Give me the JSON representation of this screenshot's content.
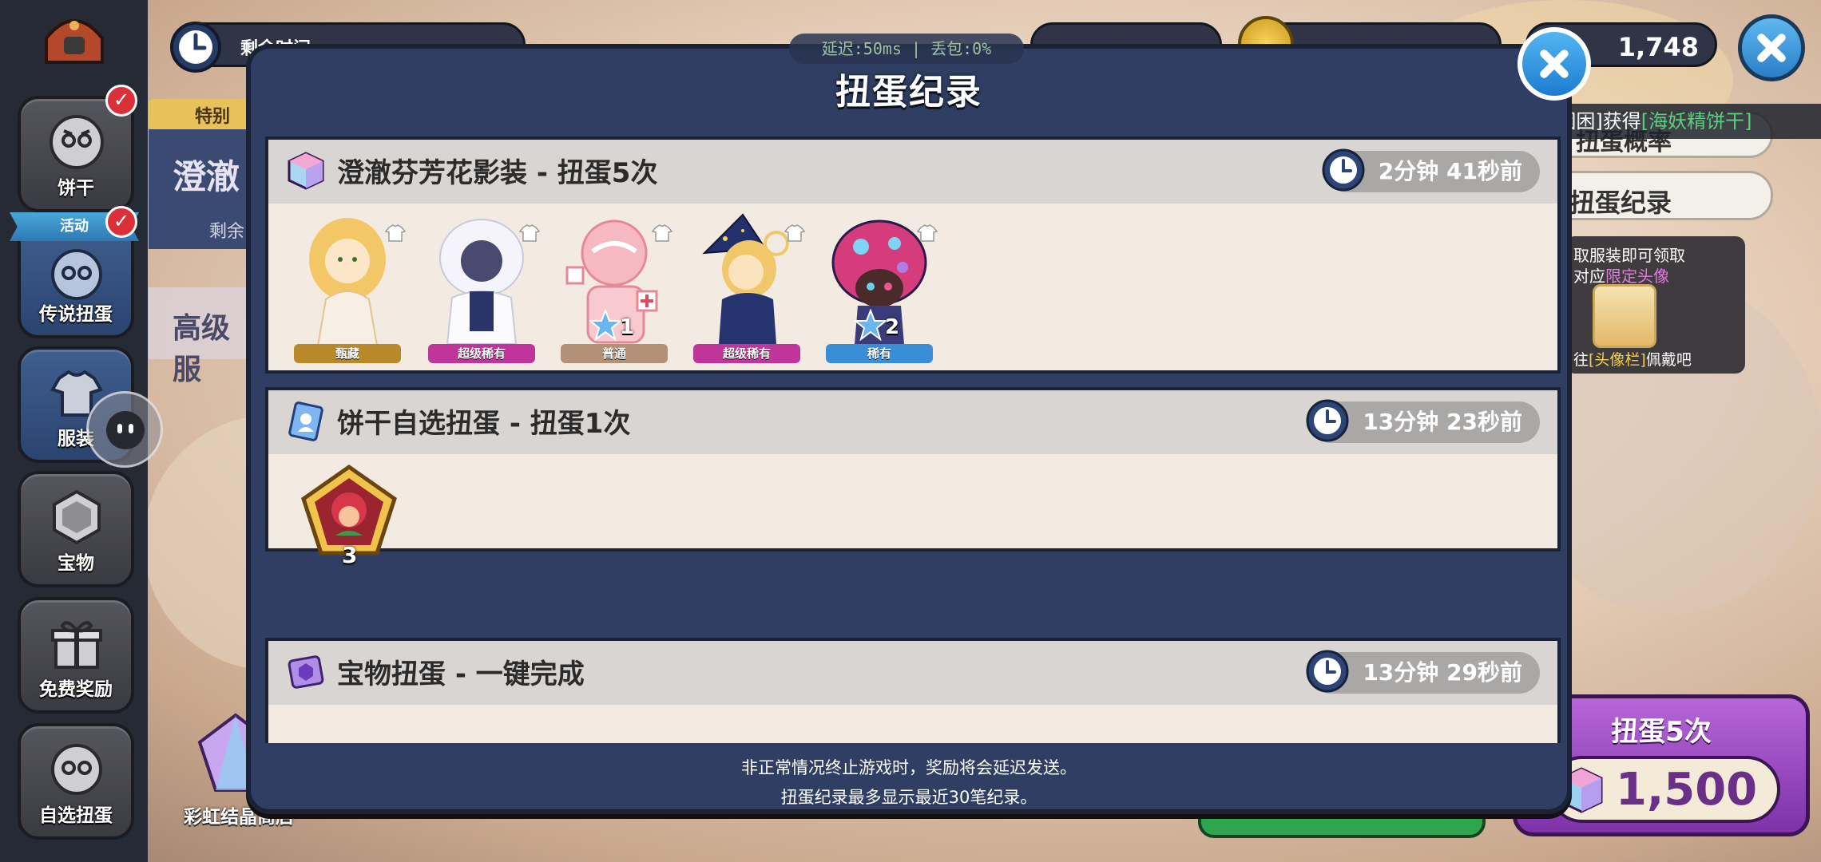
{
  "sidebar": {
    "items": [
      {
        "label": "饼干",
        "badge": "✓"
      },
      {
        "label": "传说扭蛋",
        "ribbon": "活动",
        "badge": "✓"
      },
      {
        "label": "服装"
      },
      {
        "label": "宝物"
      },
      {
        "label": "免费奖励"
      },
      {
        "label": "自选扭蛋"
      }
    ]
  },
  "background": {
    "timer_label": "剩余时间",
    "tab_special": "特别",
    "banner_title": "澄澈",
    "banner_remaining": "剩余",
    "advanced_label": "高级服",
    "rainbow_shop": "彩虹结晶商店",
    "crystal_count": "1,748",
    "right_panel_btn1": "扭蛋概率",
    "right_panel_btn2": "扭蛋纪录",
    "promo_line1": "取服装即可领取",
    "promo_line2a": "对应",
    "promo_line2b": "限定头像",
    "promo_line3a": "往",
    "promo_line3b": "[头像栏]",
    "promo_line3c": "佩戴吧",
    "gacha_button_label": "扭蛋5次",
    "gacha_button_cost": "1,500"
  },
  "notification": {
    "user": "[困困困]",
    "verb": "获得",
    "item": "[海妖精饼干]"
  },
  "status": {
    "ping_text": "延迟:50ms | 丢包:0%"
  },
  "dialog": {
    "title": "扭蛋纪录",
    "records": [
      {
        "title": "澄澈芬芳花影装 - 扭蛋5次",
        "time": "2分钟 41秒前",
        "items": [
          {
            "rarity": "甄藏",
            "rarity_color": "#b8892a"
          },
          {
            "rarity": "超级稀有",
            "rarity_color": "#c0359a",
            "count": ""
          },
          {
            "rarity": "普通",
            "rarity_color": "#b39176",
            "count": "1"
          },
          {
            "rarity": "超级稀有",
            "rarity_color": "#c0359a"
          },
          {
            "rarity": "稀有",
            "rarity_color": "#3a8ed8",
            "count": "2"
          }
        ]
      },
      {
        "title": "饼干自选扭蛋 - 扭蛋1次",
        "time": "13分钟 23秒前",
        "items": [
          {
            "count": "3"
          }
        ]
      },
      {
        "title": "宝物扭蛋 - 一键完成",
        "time": "13分钟 29秒前"
      }
    ],
    "footer_line1": "非正常情况终止游戏时，奖励将会延迟发送。",
    "footer_line2": "扭蛋纪录最多显示最近30笔纪录。"
  },
  "colors": {
    "dialog_bg": "#2f3e62",
    "record_bg": "#f3ebe1",
    "header_bg": "#d8d5d3",
    "accent_blue": "#1d7bd0",
    "gacha_purple": "#9a47c4"
  }
}
